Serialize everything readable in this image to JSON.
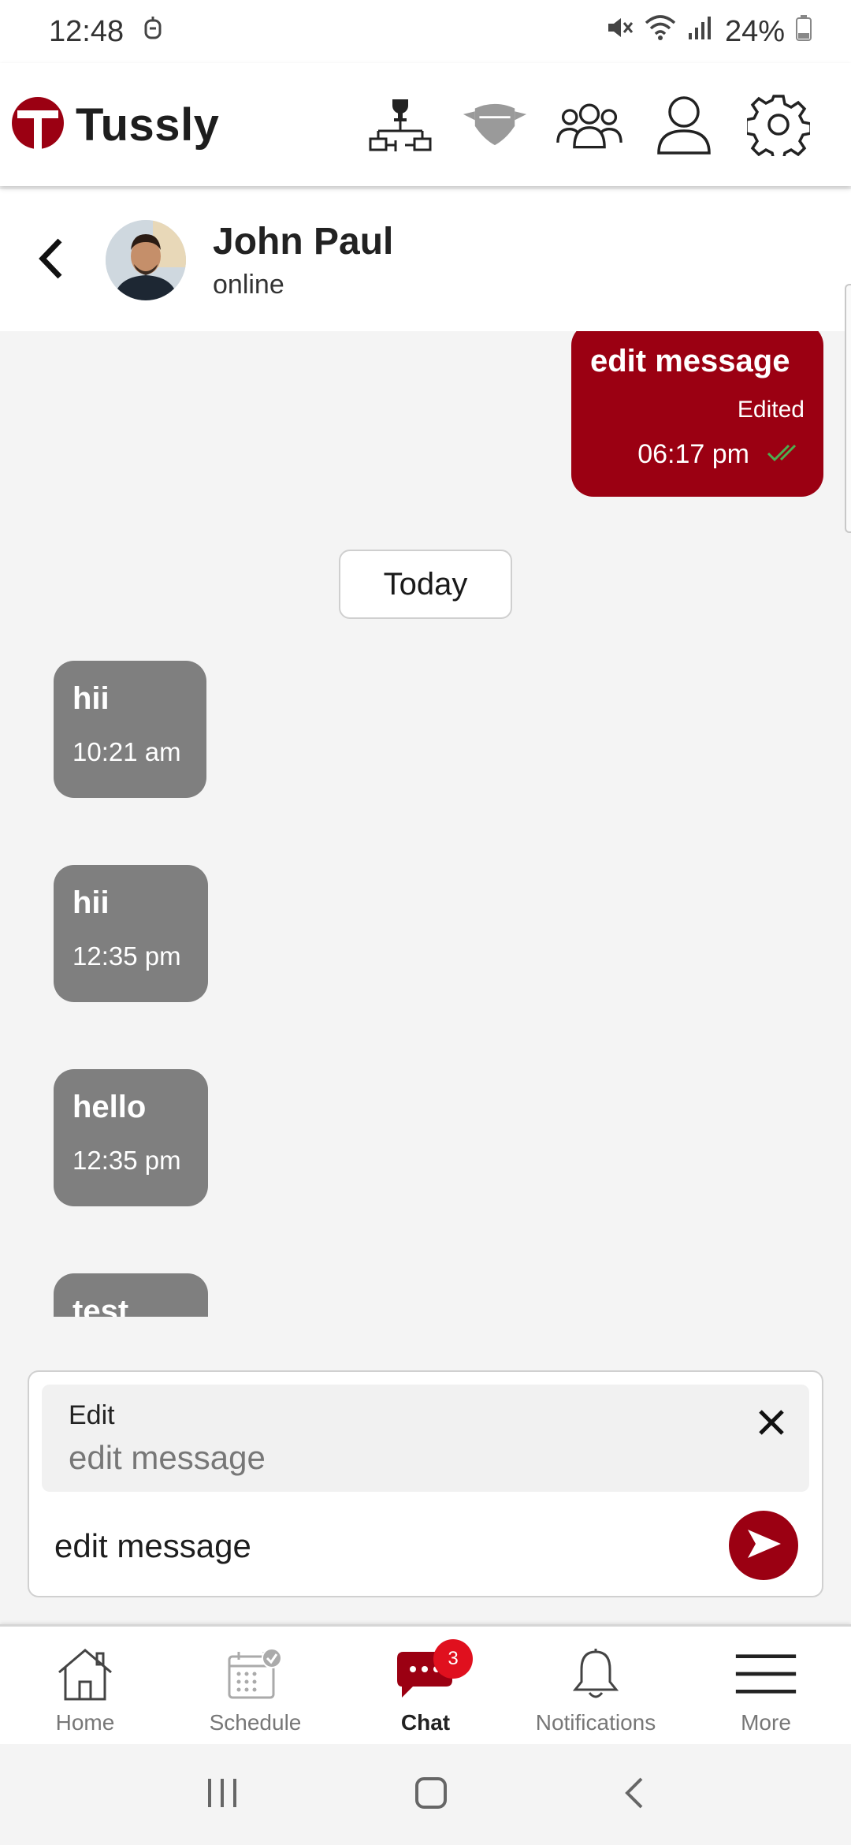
{
  "status_bar": {
    "time": "12:48",
    "battery": "24%"
  },
  "header": {
    "app_name": "Tussly"
  },
  "contact": {
    "name": "John Paul",
    "status": "online"
  },
  "messages": {
    "sent": {
      "text": "edit message",
      "edited": "Edited",
      "time": "06:17 pm"
    },
    "date_divider": "Today",
    "received": [
      {
        "text": "hii",
        "time": "10:21 am"
      },
      {
        "text": "hii",
        "time": "12:35 pm"
      },
      {
        "text": "hello",
        "time": "12:35 pm"
      },
      {
        "text": "test",
        "time": ""
      }
    ]
  },
  "composer": {
    "edit_label": "Edit",
    "edit_original": "edit message",
    "input_value": "edit message"
  },
  "bottom_nav": {
    "items": [
      {
        "label": "Home"
      },
      {
        "label": "Schedule"
      },
      {
        "label": "Chat",
        "badge": "3"
      },
      {
        "label": "Notifications"
      },
      {
        "label": "More"
      }
    ]
  },
  "colors": {
    "accent": "#9b0012",
    "received_bubble": "#7f7f7f",
    "badge": "#e0101e",
    "read_check": "#4caf50"
  }
}
